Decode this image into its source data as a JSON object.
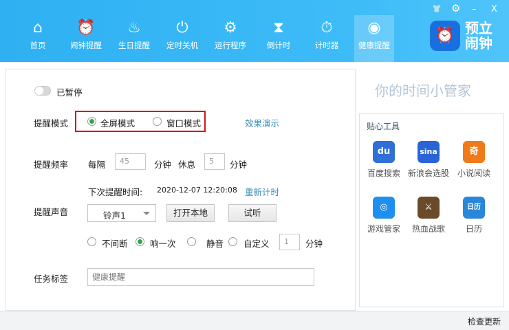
{
  "nav": [
    {
      "label": "首页",
      "icon": "home-icon",
      "glyph": "⌂"
    },
    {
      "label": "闹钟提醒",
      "icon": "alarm-clock-icon",
      "glyph": "⏰"
    },
    {
      "label": "生日提醒",
      "icon": "cake-icon",
      "glyph": "♨"
    },
    {
      "label": "定时关机",
      "icon": "power-icon",
      "glyph": "⏻"
    },
    {
      "label": "运行程序",
      "icon": "gears-icon",
      "glyph": "⚙"
    },
    {
      "label": "倒计时",
      "icon": "hourglass-icon",
      "glyph": "⧗"
    },
    {
      "label": "计时器",
      "icon": "stopwatch-icon",
      "glyph": "⏱"
    },
    {
      "label": "健康提醒",
      "icon": "eye-icon",
      "glyph": "◉"
    }
  ],
  "window": {
    "skin": "👕",
    "settings": "⚙",
    "minimize": "–",
    "close": "X"
  },
  "brand": {
    "name": "预立闹钟",
    "logo_glyph": "⏰"
  },
  "form": {
    "pause_label": "已暂停",
    "mode_label": "提醒模式",
    "mode_full": "全屏模式",
    "mode_window": "窗口模式",
    "demo_link": "效果演示",
    "freq_label": "提醒频率",
    "every": "每隔",
    "every_value": "45",
    "minutes1": "分钟",
    "rest": "休息",
    "rest_value": "5",
    "minutes2": "分钟",
    "next_label": "下次提醒时间:",
    "next_time": "2020-12-07 12:20:08",
    "reset_link": "重新计时",
    "sound_label": "提醒声音",
    "sound_value": "铃声1",
    "open_local": "打开本地",
    "listen": "试听",
    "opt_continuous": "不间断",
    "opt_once": "响一次",
    "opt_mute": "静音",
    "opt_custom": "自定义",
    "custom_value": "1",
    "minutes3": "分钟",
    "tag_label": "任务标签",
    "tag_placeholder": "健康提醒"
  },
  "right": {
    "slogan": "你的时间小管家",
    "tools_title": "贴心工具",
    "tools": [
      {
        "label": "百度搜索",
        "glyph": "du",
        "color": "#2f6fd6"
      },
      {
        "label": "新浪会选股",
        "glyph": "sina",
        "color": "#2a63d8"
      },
      {
        "label": "小说阅读",
        "glyph": "奇",
        "color": "#f07a1a"
      },
      {
        "label": "游戏管家",
        "glyph": "◎",
        "color": "#1e8ff0"
      },
      {
        "label": "热血战歌",
        "glyph": "⚔",
        "color": "#6b4a2a"
      },
      {
        "label": "日历",
        "glyph": "日历",
        "color": "#2a86d8"
      }
    ]
  },
  "footer": {
    "check_update": "检查更新"
  }
}
